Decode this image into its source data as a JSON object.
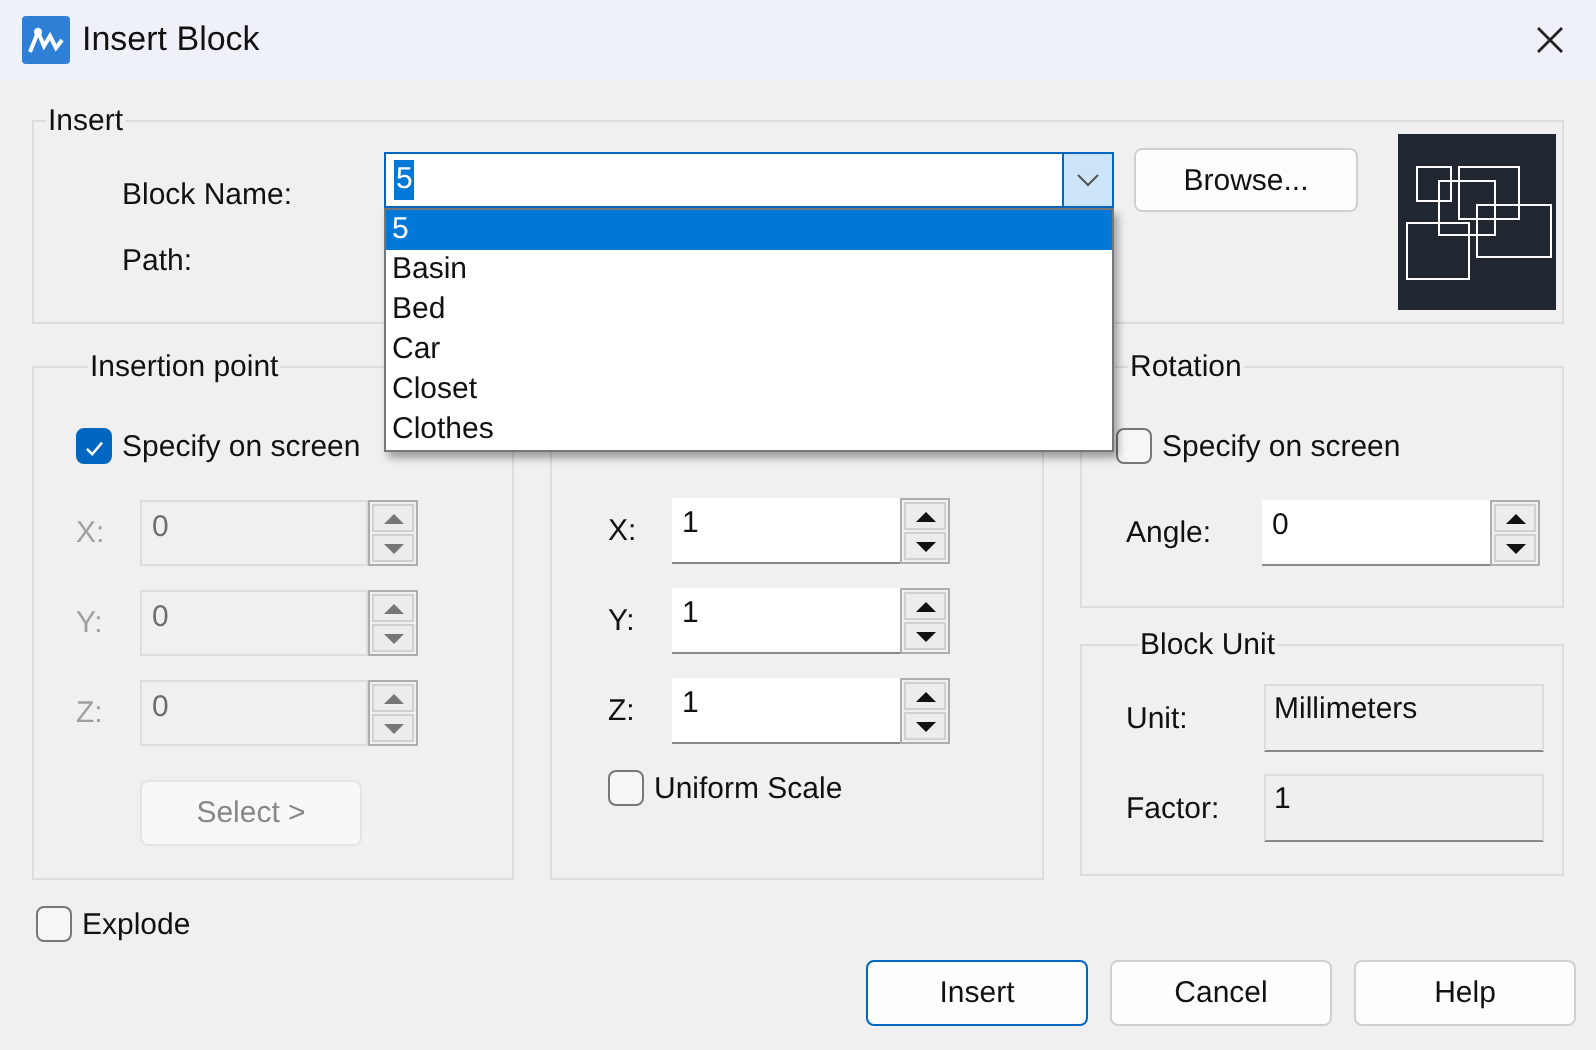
{
  "window": {
    "title": "Insert Block"
  },
  "insert": {
    "title": "Insert",
    "block_name": {
      "label": "Block Name:",
      "value": "5",
      "value_selected": true,
      "expanded": true,
      "options": [
        {
          "label": "5",
          "selected": true
        },
        {
          "label": "Basin",
          "selected": false
        },
        {
          "label": "Bed",
          "selected": false
        },
        {
          "label": "Car",
          "selected": false
        },
        {
          "label": "Closet",
          "selected": false
        },
        {
          "label": "Clothes",
          "selected": false
        }
      ]
    },
    "browse_button": "Browse...",
    "path": {
      "label": "Path:"
    }
  },
  "insertion_point": {
    "title": "Insertion point",
    "specify_on_screen": {
      "label": "Specify on screen",
      "checked": true
    },
    "fields": [
      {
        "label": "X:",
        "value": "0",
        "disabled": true
      },
      {
        "label": "Y:",
        "value": "0",
        "disabled": true
      },
      {
        "label": "Z:",
        "value": "0",
        "disabled": true
      }
    ],
    "select_button": {
      "label": "Select >",
      "disabled": true
    }
  },
  "scale": {
    "fields": [
      {
        "label": "X:",
        "value": "1",
        "disabled": false
      },
      {
        "label": "Y:",
        "value": "1",
        "disabled": false
      },
      {
        "label": "Z:",
        "value": "1",
        "disabled": false
      }
    ],
    "uniform_scale": {
      "label": "Uniform Scale",
      "checked": false
    }
  },
  "rotation": {
    "title": "Rotation",
    "specify_on_screen": {
      "label": "Specify on screen",
      "checked": false
    },
    "angle": {
      "label": "Angle:",
      "value": "0",
      "disabled": false
    }
  },
  "block_unit": {
    "title": "Block Unit",
    "fields": [
      {
        "label": "Unit:",
        "value": "Millimeters"
      },
      {
        "label": "Factor:",
        "value": "1"
      }
    ]
  },
  "explode": {
    "label": "Explode",
    "checked": false
  },
  "buttons": [
    {
      "label": "Insert",
      "default": true
    },
    {
      "label": "Cancel",
      "default": false
    },
    {
      "label": "Help",
      "default": false
    }
  ]
}
